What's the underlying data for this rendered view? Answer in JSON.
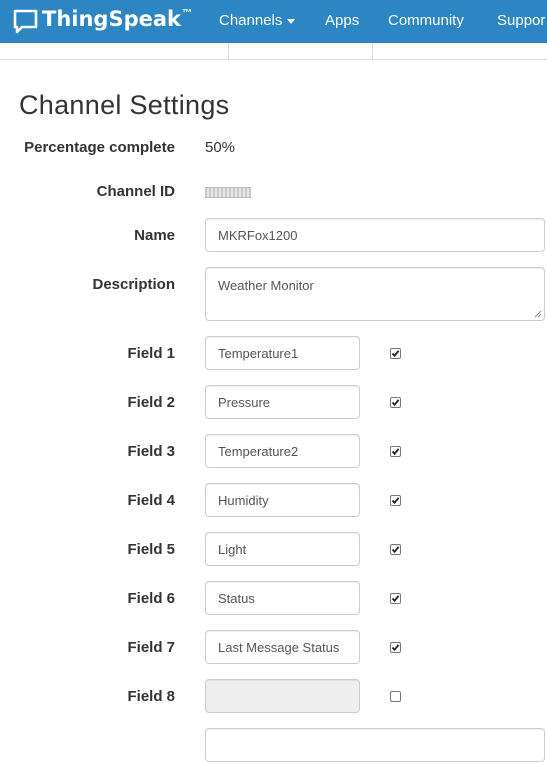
{
  "navbar": {
    "brand": "ThingSpeak",
    "brand_tm": "™",
    "items": [
      {
        "label": "Channels",
        "has_dropdown": true
      },
      {
        "label": "Apps"
      },
      {
        "label": "Community"
      },
      {
        "label": "Suppor"
      }
    ],
    "colors": {
      "background": "#2b86c3",
      "text": "#ffffff"
    }
  },
  "page": {
    "title": "Channel Settings"
  },
  "form": {
    "percentage_label": "Percentage complete",
    "percentage_value": "50%",
    "channel_id_label": "Channel ID",
    "name_label": "Name",
    "name_value": "MKRFox1200",
    "description_label": "Description",
    "description_value": "Weather Monitor",
    "fields": [
      {
        "label": "Field 1",
        "value": "Temperature1",
        "checked": true
      },
      {
        "label": "Field 2",
        "value": "Pressure",
        "checked": true
      },
      {
        "label": "Field 3",
        "value": "Temperature2",
        "checked": true
      },
      {
        "label": "Field 4",
        "value": "Humidity",
        "checked": true
      },
      {
        "label": "Field 5",
        "value": "Light",
        "checked": true
      },
      {
        "label": "Field 6",
        "value": "Status",
        "checked": true
      },
      {
        "label": "Field 7",
        "value": "Last Message Status",
        "checked": true
      },
      {
        "label": "Field 8",
        "value": "",
        "checked": false,
        "disabled": true
      }
    ]
  }
}
